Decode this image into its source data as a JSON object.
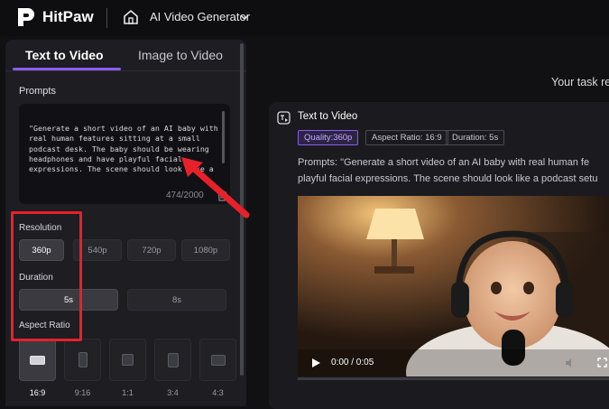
{
  "header": {
    "brand": "HitPaw",
    "app_name": "AI Video Generator"
  },
  "left_panel": {
    "tabs": [
      {
        "label": "Text to Video",
        "active": true
      },
      {
        "label": "Image to Video",
        "active": false
      }
    ],
    "prompts_label": "Prompts",
    "prompt_text": "\"Generate a short video of an AI baby with real human features sitting at a small podcast desk. The baby should be wearing headphones and have playful facial expressions. The scene should look like a podcast setup with a mic, front and soft lighting. The background",
    "char_count": "474/2000",
    "resolution": {
      "label": "Resolution",
      "options": [
        "360p",
        "540p",
        "720p",
        "1080p"
      ],
      "selected": "360p"
    },
    "duration": {
      "label": "Duration",
      "options": [
        "5s",
        "8s"
      ],
      "selected": "5s"
    },
    "aspect_ratio": {
      "label": "Aspect Ratio",
      "options": [
        "16:9",
        "9:16",
        "1:1",
        "3:4",
        "4:3"
      ],
      "selected": "16:9"
    }
  },
  "main": {
    "task_title": "Your task re",
    "card": {
      "title": "Text to Video",
      "chips": {
        "quality": "Quality:360p",
        "aspect": "Aspect Ratio: 16:9",
        "duration": "Duration: 5s"
      },
      "prompt_line1": "Prompts:  \"Generate a short video of an AI baby with real human fe",
      "prompt_line2": "playful facial expressions. The scene should look like a podcast setu"
    },
    "video": {
      "time": "0:00 / 0:05",
      "progress": 0
    }
  },
  "colors": {
    "accent": "#8b5cf6",
    "annotation_red": "#e8202a",
    "background": "#111114"
  },
  "icons": [
    "hitpaw-logo-icon",
    "home-icon",
    "chevron-down-icon",
    "trash-icon",
    "text-to-video-icon",
    "play-icon",
    "volume-icon",
    "fullscreen-icon"
  ]
}
